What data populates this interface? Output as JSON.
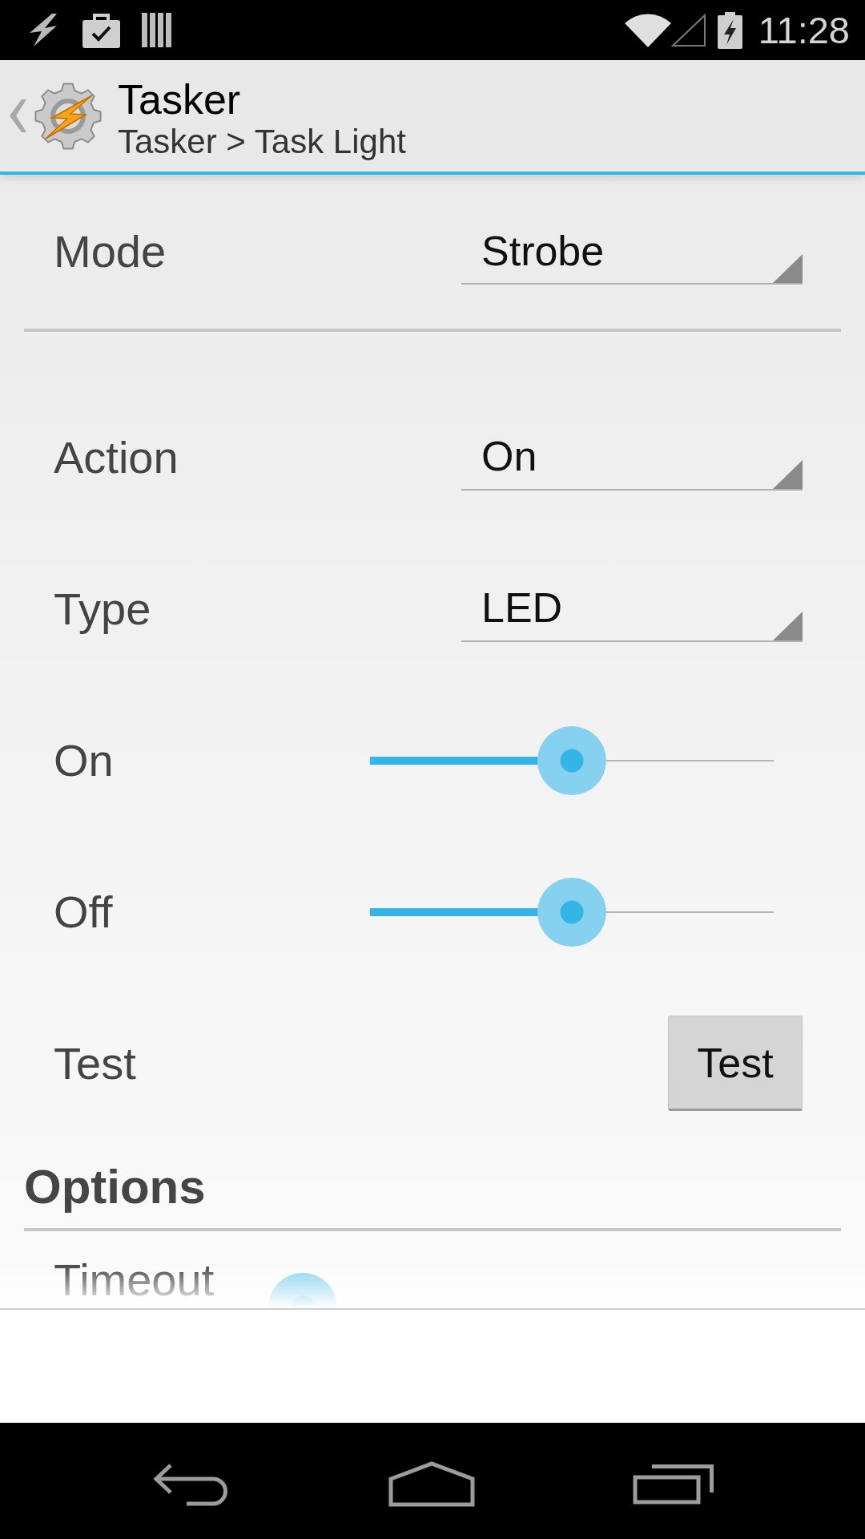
{
  "status_bar": {
    "time": "11:28"
  },
  "action_bar": {
    "title": "Tasker",
    "subtitle": "Tasker > Task Light"
  },
  "top_field": {
    "kind": "dropdown",
    "label": "Mode",
    "value": "Strobe"
  },
  "fields": [
    {
      "kind": "dropdown",
      "label": "Action",
      "value": "On"
    },
    {
      "kind": "dropdown",
      "label": "Type",
      "value": "LED"
    },
    {
      "kind": "slider",
      "label": "On",
      "level": 0.5
    },
    {
      "kind": "slider",
      "label": "Off",
      "level": 0.5
    },
    {
      "kind": "button",
      "label": "Test",
      "button": "Test"
    }
  ],
  "options": {
    "title": "Options",
    "fields": [
      {
        "kind": "slider",
        "label": "Timeout",
        "level": 0
      }
    ]
  }
}
